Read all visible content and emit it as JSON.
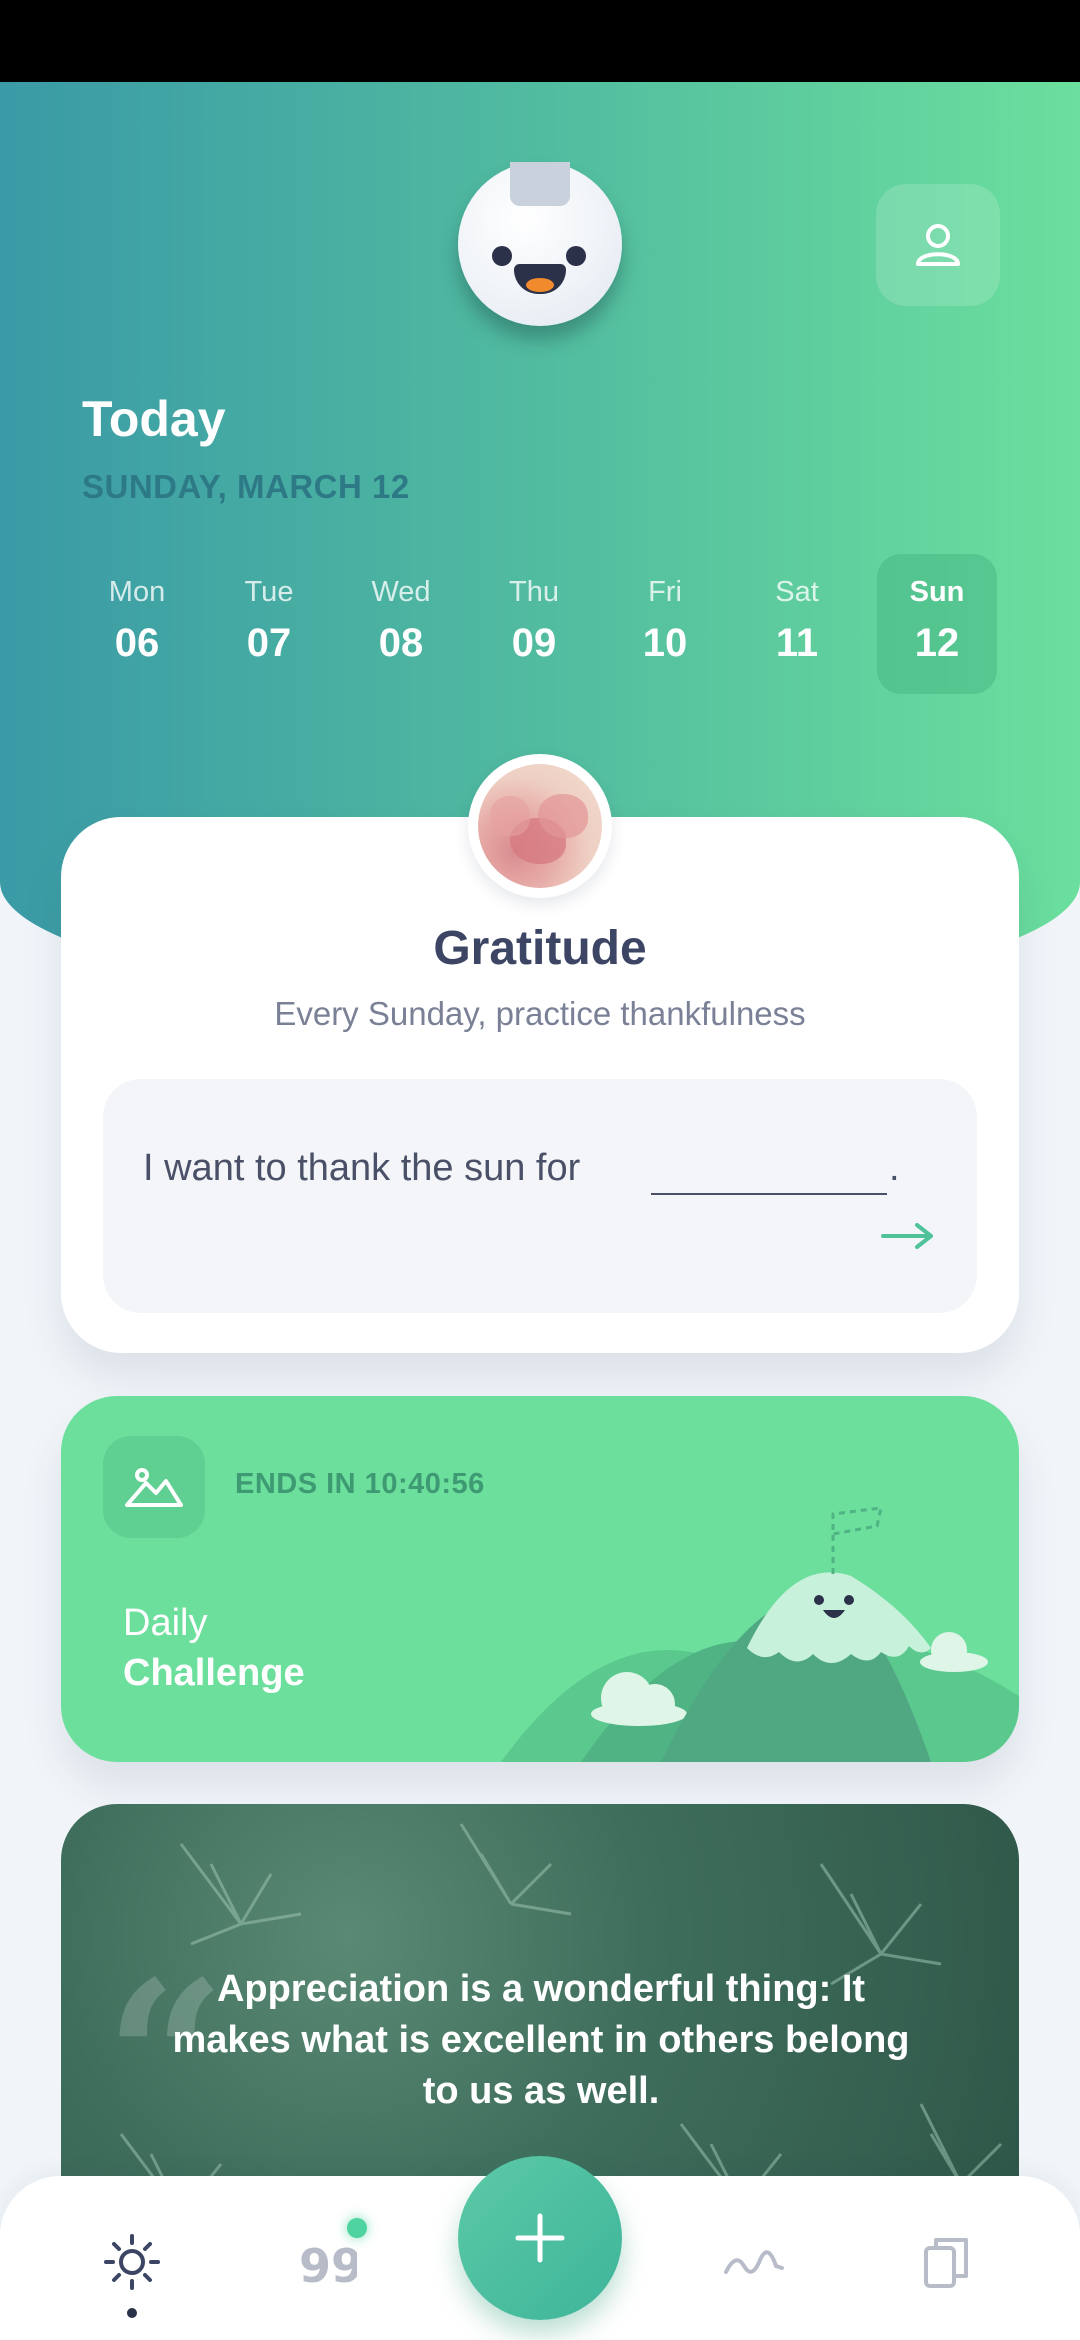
{
  "header": {
    "title": "Today",
    "date": "SUNDAY, MARCH 12"
  },
  "week": [
    {
      "day": "Mon",
      "date": "06",
      "active": false
    },
    {
      "day": "Tue",
      "date": "07",
      "active": false
    },
    {
      "day": "Wed",
      "date": "08",
      "active": false
    },
    {
      "day": "Thu",
      "date": "09",
      "active": false
    },
    {
      "day": "Fri",
      "date": "10",
      "active": false
    },
    {
      "day": "Sat",
      "date": "11",
      "active": false
    },
    {
      "day": "Sun",
      "date": "12",
      "active": true
    }
  ],
  "gratitude": {
    "title": "Gratitude",
    "subtitle": "Every Sunday, practice thankfulness",
    "prompt": "I want to thank the sun for",
    "prompt_end": "."
  },
  "challenge": {
    "ends": "ENDS IN 10:40:56",
    "line1": "Daily",
    "line2": "Challenge"
  },
  "quote": {
    "text": "Appreciation is a wonderful thing: It makes what is excellent in others belong to us as well."
  },
  "nav": {
    "items": [
      "sun-icon",
      "quote-icon",
      "plus-icon",
      "wave-icon",
      "cards-icon"
    ]
  },
  "colors": {
    "accent": "#6ddf9d",
    "hero_start": "#3a9aa6",
    "hero_end": "#6bdf9d",
    "text_dark": "#3c4664"
  }
}
